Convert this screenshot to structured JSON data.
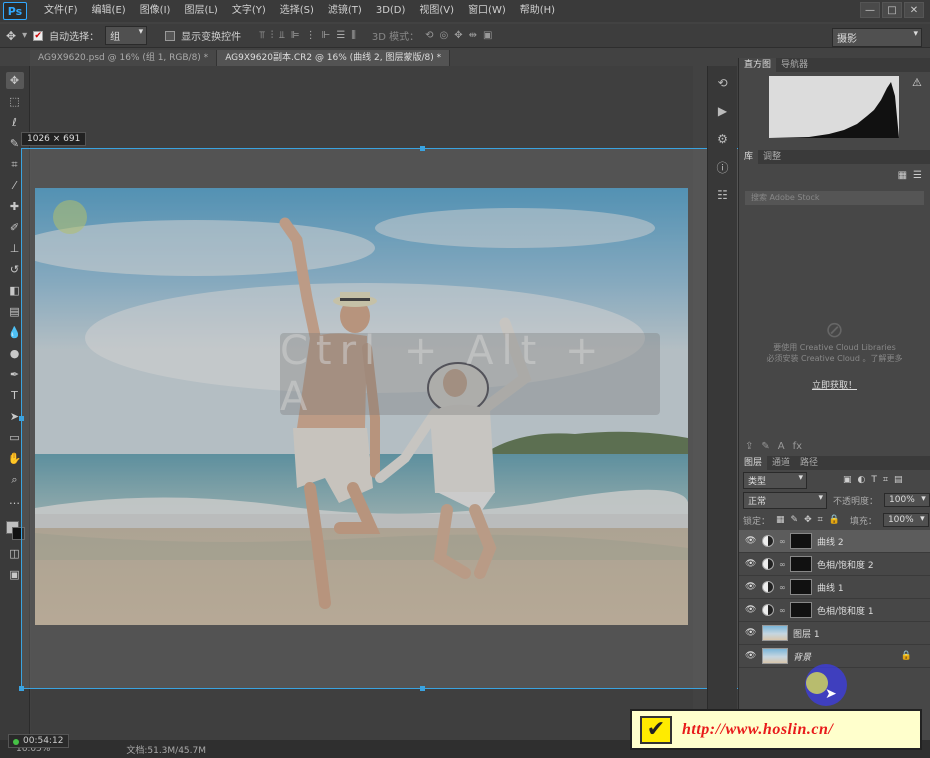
{
  "app": {
    "logo": "Ps"
  },
  "menu": [
    "文件(F)",
    "编辑(E)",
    "图像(I)",
    "图层(L)",
    "文字(Y)",
    "选择(S)",
    "滤镜(T)",
    "3D(D)",
    "视图(V)",
    "窗口(W)",
    "帮助(H)"
  ],
  "window_controls": [
    "—",
    "□",
    "✕"
  ],
  "options": {
    "auto_select_label": "自动选择：",
    "auto_select_value": "组",
    "show_transform_label": "显示变换控件",
    "mode_3d": "3D 模式：",
    "workspace": "摄影"
  },
  "tabs": [
    {
      "label": "AG9X9620.psd @ 16% (组 1, RGB/8) *",
      "active": false
    },
    {
      "label": "AG9X9620副本.CR2 @ 16% (曲线 2, 图层蒙版/8) *",
      "active": true
    }
  ],
  "canvas": {
    "size_tooltip": "1026 × 691",
    "hint_text": "Ctrl + Alt + A"
  },
  "panels": {
    "histogram_tabs": [
      "直方图",
      "导航器"
    ],
    "library_tabs": [
      "库",
      "调整"
    ],
    "library_search_placeholder": "搜索 Adobe Stock",
    "library_message_1": "要使用 Creative Cloud Libraries",
    "library_message_2": "必须安装 Creative Cloud 。了解更多",
    "library_link": "立即获取！",
    "layers_tabs": [
      "图层",
      "通道",
      "路径"
    ],
    "layer_filter": "类型",
    "blend_mode": "正常",
    "opacity_label": "不透明度：",
    "opacity_value": "100%",
    "lock_label": "锁定：",
    "fill_label": "填充：",
    "fill_value": "100%",
    "layers": [
      {
        "name": "曲线 2",
        "type": "adjust",
        "selected": true
      },
      {
        "name": "色相/饱和度 2",
        "type": "adjust",
        "selected": false
      },
      {
        "name": "曲线 1",
        "type": "adjust",
        "selected": false
      },
      {
        "name": "色相/饱和度 1",
        "type": "adjust",
        "selected": false
      },
      {
        "name": "图层 1",
        "type": "pixel",
        "selected": false
      },
      {
        "name": "背景",
        "type": "background",
        "selected": false
      }
    ]
  },
  "status": {
    "timer": "00:54:12",
    "zoom": "16.05%",
    "doc_info": "文档:51.3M/45.7M"
  },
  "watermark": {
    "check": "✔",
    "text": "http://www.hoslin.cn/"
  }
}
